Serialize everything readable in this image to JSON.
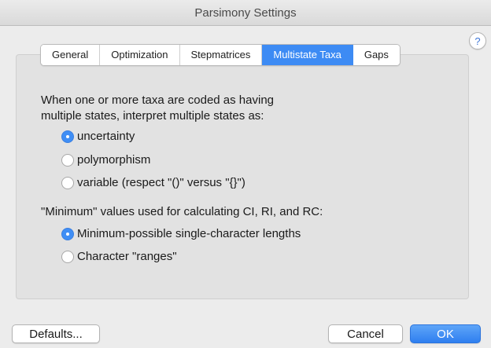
{
  "window": {
    "title": "Parsimony Settings"
  },
  "help": {
    "label": "?"
  },
  "tabs": [
    {
      "label": "General",
      "active": false
    },
    {
      "label": "Optimization",
      "active": false
    },
    {
      "label": "Stepmatrices",
      "active": false
    },
    {
      "label": "Multistate Taxa",
      "active": true
    },
    {
      "label": "Gaps",
      "active": false
    }
  ],
  "multistate": {
    "intro_line1": "When one or more taxa are coded as having",
    "intro_line2": "multiple states, interpret multiple states as:",
    "options": [
      {
        "label": "uncertainty",
        "checked": true
      },
      {
        "label": "polymorphism",
        "checked": false
      },
      {
        "label": "variable (respect \"()\" versus \"{}\")",
        "checked": false
      }
    ]
  },
  "minimum": {
    "label": "\"Minimum\" values used for calculating CI, RI, and RC:",
    "options": [
      {
        "label": "Minimum-possible single-character lengths",
        "checked": true
      },
      {
        "label": "Character \"ranges\"",
        "checked": false
      }
    ]
  },
  "buttons": {
    "defaults": "Defaults...",
    "cancel": "Cancel",
    "ok": "OK"
  },
  "colors": {
    "accent": "#3d8bf4",
    "window_bg": "#ececec",
    "panel_bg": "#e2e2e2"
  }
}
